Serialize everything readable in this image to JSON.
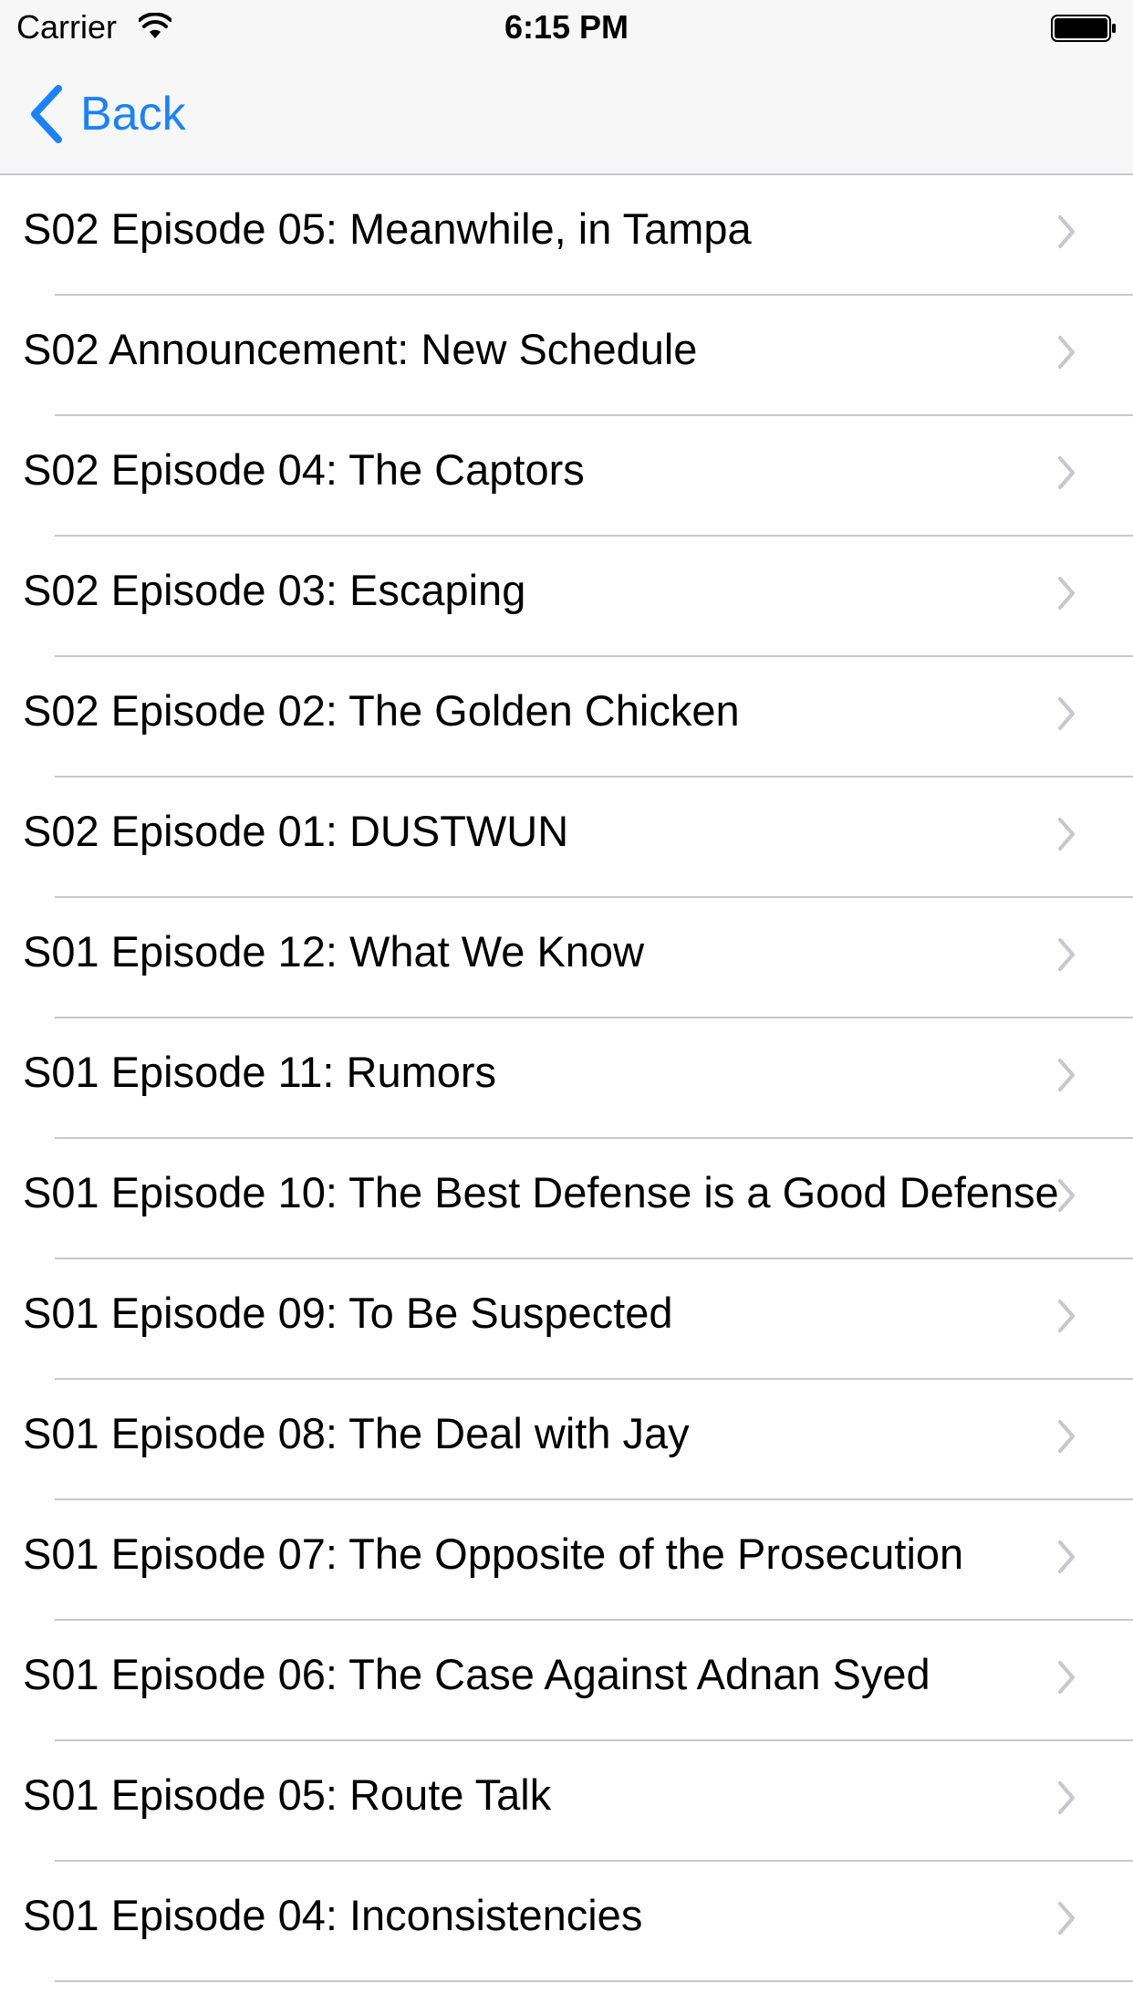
{
  "status_bar": {
    "carrier": "Carrier",
    "time": "6:15 PM",
    "wifi_icon": "wifi-icon",
    "battery_icon": "battery-icon"
  },
  "nav": {
    "back_label": "Back",
    "back_icon": "chevron-left-icon",
    "accent_color": "#1a82fb"
  },
  "episodes": [
    {
      "title": "S02 Episode 05: Meanwhile, in Tampa"
    },
    {
      "title": "S02 Announcement: New Schedule"
    },
    {
      "title": "S02 Episode 04: The Captors"
    },
    {
      "title": "S02 Episode 03: Escaping"
    },
    {
      "title": "S02 Episode 02: The Golden Chicken"
    },
    {
      "title": "S02 Episode 01: DUSTWUN"
    },
    {
      "title": "S01 Episode 12: What We Know"
    },
    {
      "title": "S01 Episode 11: Rumors"
    },
    {
      "title": "S01 Episode 10: The Best Defense is a Good Defense"
    },
    {
      "title": "S01 Episode 09: To Be Suspected"
    },
    {
      "title": "S01 Episode 08: The Deal with Jay"
    },
    {
      "title": "S01 Episode 07: The Opposite of the Prosecution"
    },
    {
      "title": "S01 Episode 06: The Case Against Adnan Syed"
    },
    {
      "title": "S01 Episode 05: Route Talk"
    },
    {
      "title": "S01 Episode 04: Inconsistencies"
    }
  ],
  "row_icon": "chevron-right-icon",
  "separator_color": "#c8c7cc"
}
